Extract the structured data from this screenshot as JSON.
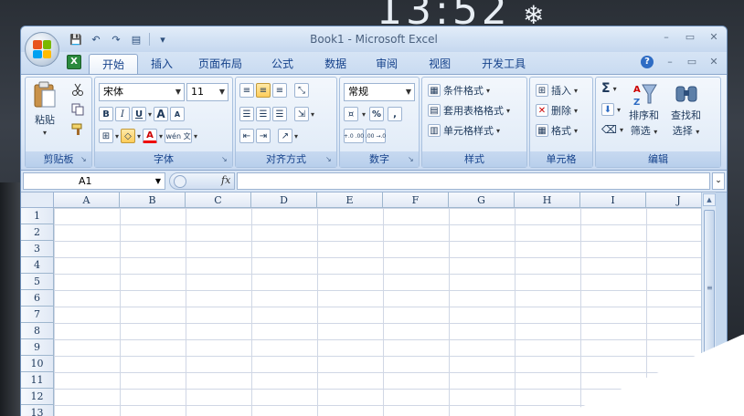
{
  "desktop": {
    "clock": "13:52",
    "snow": "❄"
  },
  "titlebar": {
    "title": "Book1 - Microsoft Excel",
    "qat": {
      "save": "💾",
      "undo": "↶",
      "redo": "↷",
      "print": "▤",
      "customize": "▾"
    },
    "controls": {
      "minimize": "–",
      "maximize": "▭",
      "close": "✕"
    }
  },
  "tabs": {
    "excel_icon": "X",
    "items": [
      "开始",
      "插入",
      "页面布局",
      "公式",
      "数据",
      "审阅",
      "视图",
      "开发工具"
    ],
    "help": "?",
    "ribbon_min": "–",
    "restore": "▭",
    "close": "✕"
  },
  "ribbon": {
    "clipboard": {
      "label": "剪贴板",
      "paste": "粘贴"
    },
    "font": {
      "label": "字体",
      "font_name": "宋体",
      "font_size": "11",
      "bold": "B",
      "italic": "I",
      "underline": "U",
      "grow": "A",
      "shrink": "A",
      "color": "A",
      "phonetic": "wén 文"
    },
    "alignment": {
      "label": "对齐方式"
    },
    "number": {
      "label": "数字",
      "format": "常规",
      "percent": "%",
      "comma": ",",
      "inc_decimal": "+.0 .00",
      "dec_decimal": ".00 →.0"
    },
    "styles": {
      "label": "样式",
      "conditional": "条件格式",
      "table": "套用表格格式",
      "cell_styles": "单元格样式"
    },
    "cells": {
      "label": "单元格",
      "insert": "插入",
      "delete": "删除",
      "format": "格式"
    },
    "editing": {
      "label": "编辑",
      "sigma": "Σ",
      "sort_line1": "排序和",
      "sort_line2": "筛选",
      "find_line1": "查找和",
      "find_line2": "选择"
    }
  },
  "formula_bar": {
    "name_box": "A1",
    "fx": "fx",
    "value": ""
  },
  "sheet": {
    "columns": [
      "A",
      "B",
      "C",
      "D",
      "E",
      "F",
      "G",
      "H",
      "I",
      "J"
    ],
    "rows": [
      "1",
      "2",
      "3",
      "4",
      "5",
      "6",
      "7",
      "8",
      "9",
      "10",
      "11",
      "12",
      "13"
    ]
  },
  "colors": {
    "accent": "#15428b",
    "ribbon_bg": "#dbe7f6",
    "grid": "#d0d7e5"
  }
}
